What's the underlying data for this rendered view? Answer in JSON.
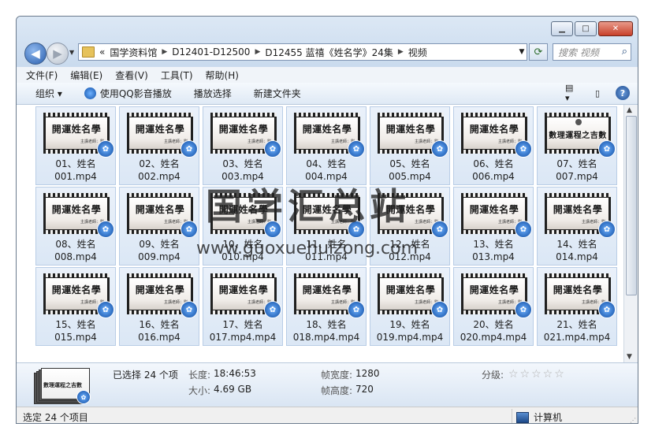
{
  "window": {
    "buttons": {
      "minimize": "▁",
      "maximize": "□",
      "close": "✕"
    }
  },
  "nav": {
    "back_glyph": "◀",
    "forward_glyph": "▶",
    "history_glyph": "▼",
    "address_overflow": "«",
    "address_crumbs": [
      "国学资料馆",
      "D12401-D12500",
      "D12455 蓝禧《姓名学》24集",
      "视频"
    ],
    "address_drop_glyph": "▼",
    "refresh_glyph": "⟳",
    "search_placeholder": "搜索 视频",
    "search_glyph": "⌕"
  },
  "menu": {
    "items": [
      "文件(F)",
      "编辑(E)",
      "查看(V)",
      "工具(T)",
      "帮助(H)"
    ]
  },
  "toolbar": {
    "organize": "组织 ▾",
    "play_qq": "使用QQ影音播放",
    "play_selection": "播放选择",
    "new_folder": "新建文件夹",
    "view_glyph": "▤ ▾",
    "pane_glyph": "▯",
    "help_glyph": "?"
  },
  "thumbnail": {
    "title": "開運姓名學",
    "subtitle": "主講老師：劉",
    "alt_title": "數理運程之吉數",
    "seal": "壹",
    "badge_glyph": "✿"
  },
  "files": [
    {
      "line1": "01、姓名",
      "line2": "001.mp4",
      "alt": false
    },
    {
      "line1": "02、姓名",
      "line2": "002.mp4",
      "alt": false
    },
    {
      "line1": "03、姓名",
      "line2": "003.mp4",
      "alt": false
    },
    {
      "line1": "04、姓名",
      "line2": "004.mp4",
      "alt": false
    },
    {
      "line1": "05、姓名",
      "line2": "005.mp4",
      "alt": false
    },
    {
      "line1": "06、姓名",
      "line2": "006.mp4",
      "alt": false
    },
    {
      "line1": "07、姓名",
      "line2": "007.mp4",
      "alt": true
    },
    {
      "line1": "08、姓名",
      "line2": "008.mp4",
      "alt": false
    },
    {
      "line1": "09、姓名",
      "line2": "009.mp4",
      "alt": false
    },
    {
      "line1": "10、姓名",
      "line2": "010.mp4",
      "alt": false
    },
    {
      "line1": "11、姓名",
      "line2": "011.mp4",
      "alt": false
    },
    {
      "line1": "12、姓名",
      "line2": "012.mp4",
      "alt": false
    },
    {
      "line1": "13、姓名",
      "line2": "013.mp4",
      "alt": false
    },
    {
      "line1": "14、姓名",
      "line2": "014.mp4",
      "alt": false
    },
    {
      "line1": "15、姓名",
      "line2": "015.mp4",
      "alt": false
    },
    {
      "line1": "16、姓名",
      "line2": "016.mp4",
      "alt": false
    },
    {
      "line1": "17、姓名",
      "line2": "017.mp4.mp4",
      "alt": false
    },
    {
      "line1": "18、姓名",
      "line2": "018.mp4.mp4",
      "alt": false
    },
    {
      "line1": "19、姓名",
      "line2": "019.mp4.mp4",
      "alt": false
    },
    {
      "line1": "20、姓名",
      "line2": "020.mp4.mp4",
      "alt": false
    },
    {
      "line1": "21、姓名",
      "line2": "021.mp4.mp4",
      "alt": false
    }
  ],
  "details": {
    "selected": "已选择 24 个项",
    "length_label": "长度:",
    "length_value": "18:46:53",
    "size_label": "大小:",
    "size_value": "4.69 GB",
    "frame_width_label": "帧宽度:",
    "frame_width_value": "1280",
    "frame_height_label": "帧高度:",
    "frame_height_value": "720",
    "rating_label": "分级:",
    "rating_stars": "☆☆☆☆☆"
  },
  "status": {
    "left": "选定 24 个项目",
    "right": "计算机",
    "grip": "⋰"
  },
  "watermark": {
    "cn": "国学汇总站",
    "url": "www.guoxuehuizong.com"
  }
}
